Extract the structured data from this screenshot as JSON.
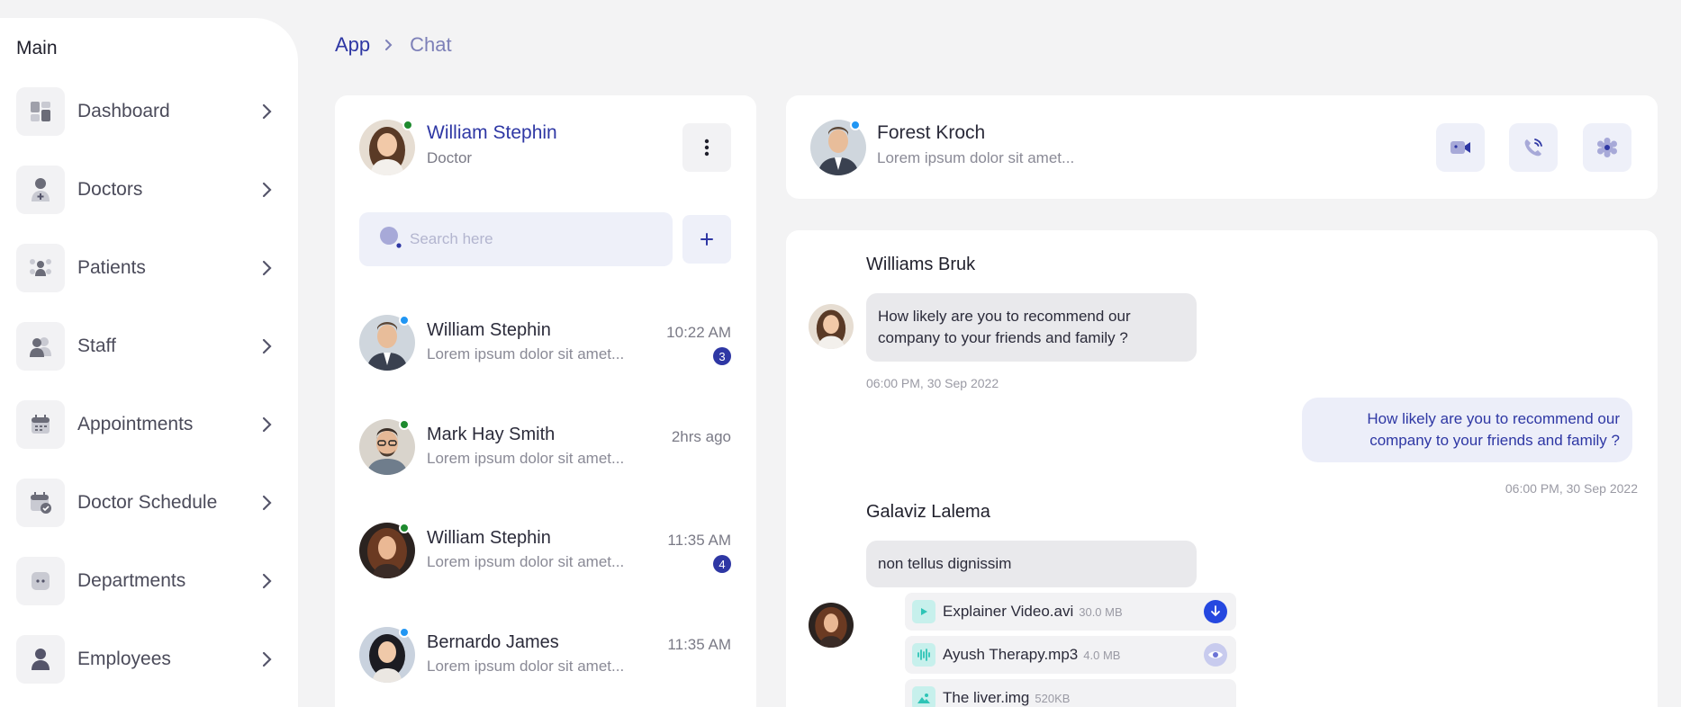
{
  "sidebar": {
    "title": "Main",
    "items": [
      {
        "label": "Dashboard",
        "icon": "dashboard-icon"
      },
      {
        "label": "Doctors",
        "icon": "doctor-icon"
      },
      {
        "label": "Patients",
        "icon": "patients-icon"
      },
      {
        "label": "Staff",
        "icon": "staff-icon"
      },
      {
        "label": "Appointments",
        "icon": "calendar-icon"
      },
      {
        "label": "Doctor Schedule",
        "icon": "schedule-icon"
      },
      {
        "label": "Departments",
        "icon": "departments-icon"
      },
      {
        "label": "Employees",
        "icon": "employee-icon"
      }
    ]
  },
  "breadcrumb": {
    "root": "App",
    "current": "Chat"
  },
  "chat_list": {
    "me": {
      "name": "William Stephin",
      "role": "Doctor"
    },
    "search": {
      "placeholder": "Search here"
    },
    "items": [
      {
        "name": "William Stephin",
        "preview": "Lorem ipsum dolor sit amet...",
        "time": "10:22 AM",
        "badge": "3"
      },
      {
        "name": "Mark Hay Smith",
        "preview": "Lorem ipsum dolor sit amet...",
        "time": "2hrs ago",
        "badge": ""
      },
      {
        "name": "William Stephin",
        "preview": "Lorem ipsum dolor sit amet...",
        "time": "11:35 AM",
        "badge": "4"
      },
      {
        "name": "Bernardo James",
        "preview": "Lorem ipsum dolor sit amet...",
        "time": "11:35 AM",
        "badge": ""
      }
    ]
  },
  "conversation": {
    "header": {
      "name": "Forest Kroch",
      "preview": "Lorem ipsum dolor sit amet..."
    },
    "messages": [
      {
        "sender": "Williams Bruk",
        "text": "How likely are you to recommend our company to your friends and family ?",
        "time": "06:00 PM, 30 Sep 2022"
      },
      {
        "text": "How likely are you to recommend our company to your friends and family ?",
        "time": "06:00 PM, 30 Sep 2022"
      },
      {
        "sender": "Galaviz Lalema",
        "text": "non tellus dignissim"
      }
    ],
    "files": [
      {
        "name": "Explainer Video.avi",
        "size": "30.0 MB",
        "action": "download-icon"
      },
      {
        "name": "Ayush Therapy.mp3",
        "size": "4.0 MB",
        "action": "eye-icon"
      },
      {
        "name": "The liver.img",
        "size": "520KB",
        "action": ""
      }
    ]
  },
  "colors": {
    "accent": "#2e37a4",
    "online": "#1e8a2e",
    "away": "#2196f3",
    "background": "#f3f3f4"
  }
}
